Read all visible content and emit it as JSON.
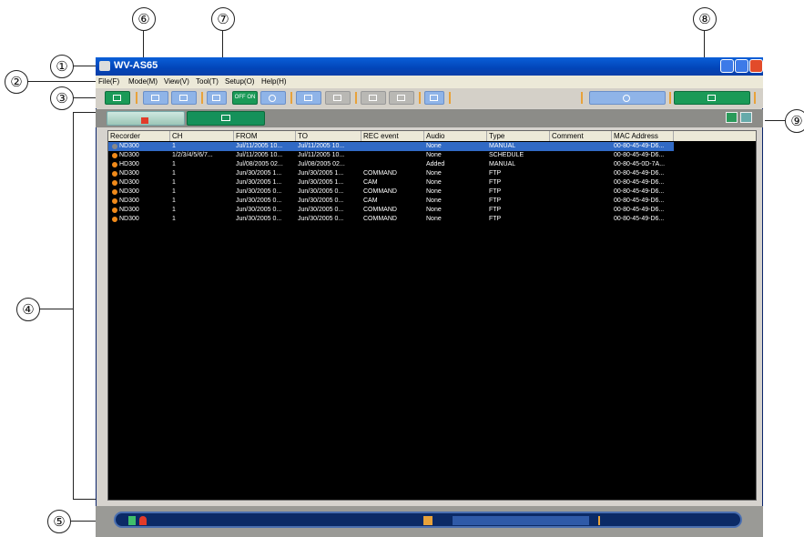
{
  "window": {
    "title": "WV-AS65"
  },
  "menu": [
    "File(F)",
    "Mode(M)",
    "View(V)",
    "Tool(T)",
    "Setup(O)",
    "Help(H)"
  ],
  "toolbar": {
    "off_label": "OFF",
    "on_label": "ON"
  },
  "list": {
    "columns": [
      "Recorder",
      "CH",
      "FROM",
      "TO",
      "REC event",
      "Audio",
      "Type",
      "Comment",
      "MAC Address"
    ],
    "rows": [
      {
        "recorder": "ND300",
        "ch": "1",
        "from": "Jul/11/2005 10...",
        "to": "Jul/11/2005 10...",
        "rec_event": "",
        "audio": "None",
        "type": "MANUAL",
        "comment": "",
        "mac": "00-80-45-49-D6...",
        "selected": true
      },
      {
        "recorder": "ND300",
        "ch": "1/2/3/4/5/6/7...",
        "from": "Jul/11/2005 10...",
        "to": "Jul/11/2005 10...",
        "rec_event": "",
        "audio": "None",
        "type": "SCHEDULE",
        "comment": "",
        "mac": "00-80-45-49-D6..."
      },
      {
        "recorder": "HD300",
        "ch": "1",
        "from": "Jul/08/2005 02...",
        "to": "Jul/08/2005 02...",
        "rec_event": "",
        "audio": "Added",
        "type": "MANUAL",
        "comment": "",
        "mac": "00-80-45-0D-7A..."
      },
      {
        "recorder": "ND300",
        "ch": "1",
        "from": "Jun/30/2005 1...",
        "to": "Jun/30/2005 1...",
        "rec_event": "COMMAND",
        "audio": "None",
        "type": "FTP",
        "comment": "",
        "mac": "00-80-45-49-D6..."
      },
      {
        "recorder": "ND300",
        "ch": "1",
        "from": "Jun/30/2005 1...",
        "to": "Jun/30/2005 1...",
        "rec_event": "CAM",
        "audio": "None",
        "type": "FTP",
        "comment": "",
        "mac": "00-80-45-49-D6..."
      },
      {
        "recorder": "ND300",
        "ch": "1",
        "from": "Jun/30/2005 0...",
        "to": "Jun/30/2005 0...",
        "rec_event": "COMMAND",
        "audio": "None",
        "type": "FTP",
        "comment": "",
        "mac": "00-80-45-49-D6..."
      },
      {
        "recorder": "ND300",
        "ch": "1",
        "from": "Jun/30/2005 0...",
        "to": "Jun/30/2005 0...",
        "rec_event": "CAM",
        "audio": "None",
        "type": "FTP",
        "comment": "",
        "mac": "00-80-45-49-D6..."
      },
      {
        "recorder": "ND300",
        "ch": "1",
        "from": "Jun/30/2005 0...",
        "to": "Jun/30/2005 0...",
        "rec_event": "COMMAND",
        "audio": "None",
        "type": "FTP",
        "comment": "",
        "mac": "00-80-45-49-D6..."
      },
      {
        "recorder": "ND300",
        "ch": "1",
        "from": "Jun/30/2005 0...",
        "to": "Jun/30/2005 0...",
        "rec_event": "COMMAND",
        "audio": "None",
        "type": "FTP",
        "comment": "",
        "mac": "00-80-45-49-D6..."
      }
    ]
  },
  "callouts": [
    "①",
    "②",
    "③",
    "④",
    "⑤",
    "⑥",
    "⑦",
    "⑧",
    "⑨"
  ],
  "colors": {
    "accent_green": "#1a9a57",
    "selection": "#316ac5",
    "indicator_orange": "#f08a1a"
  }
}
